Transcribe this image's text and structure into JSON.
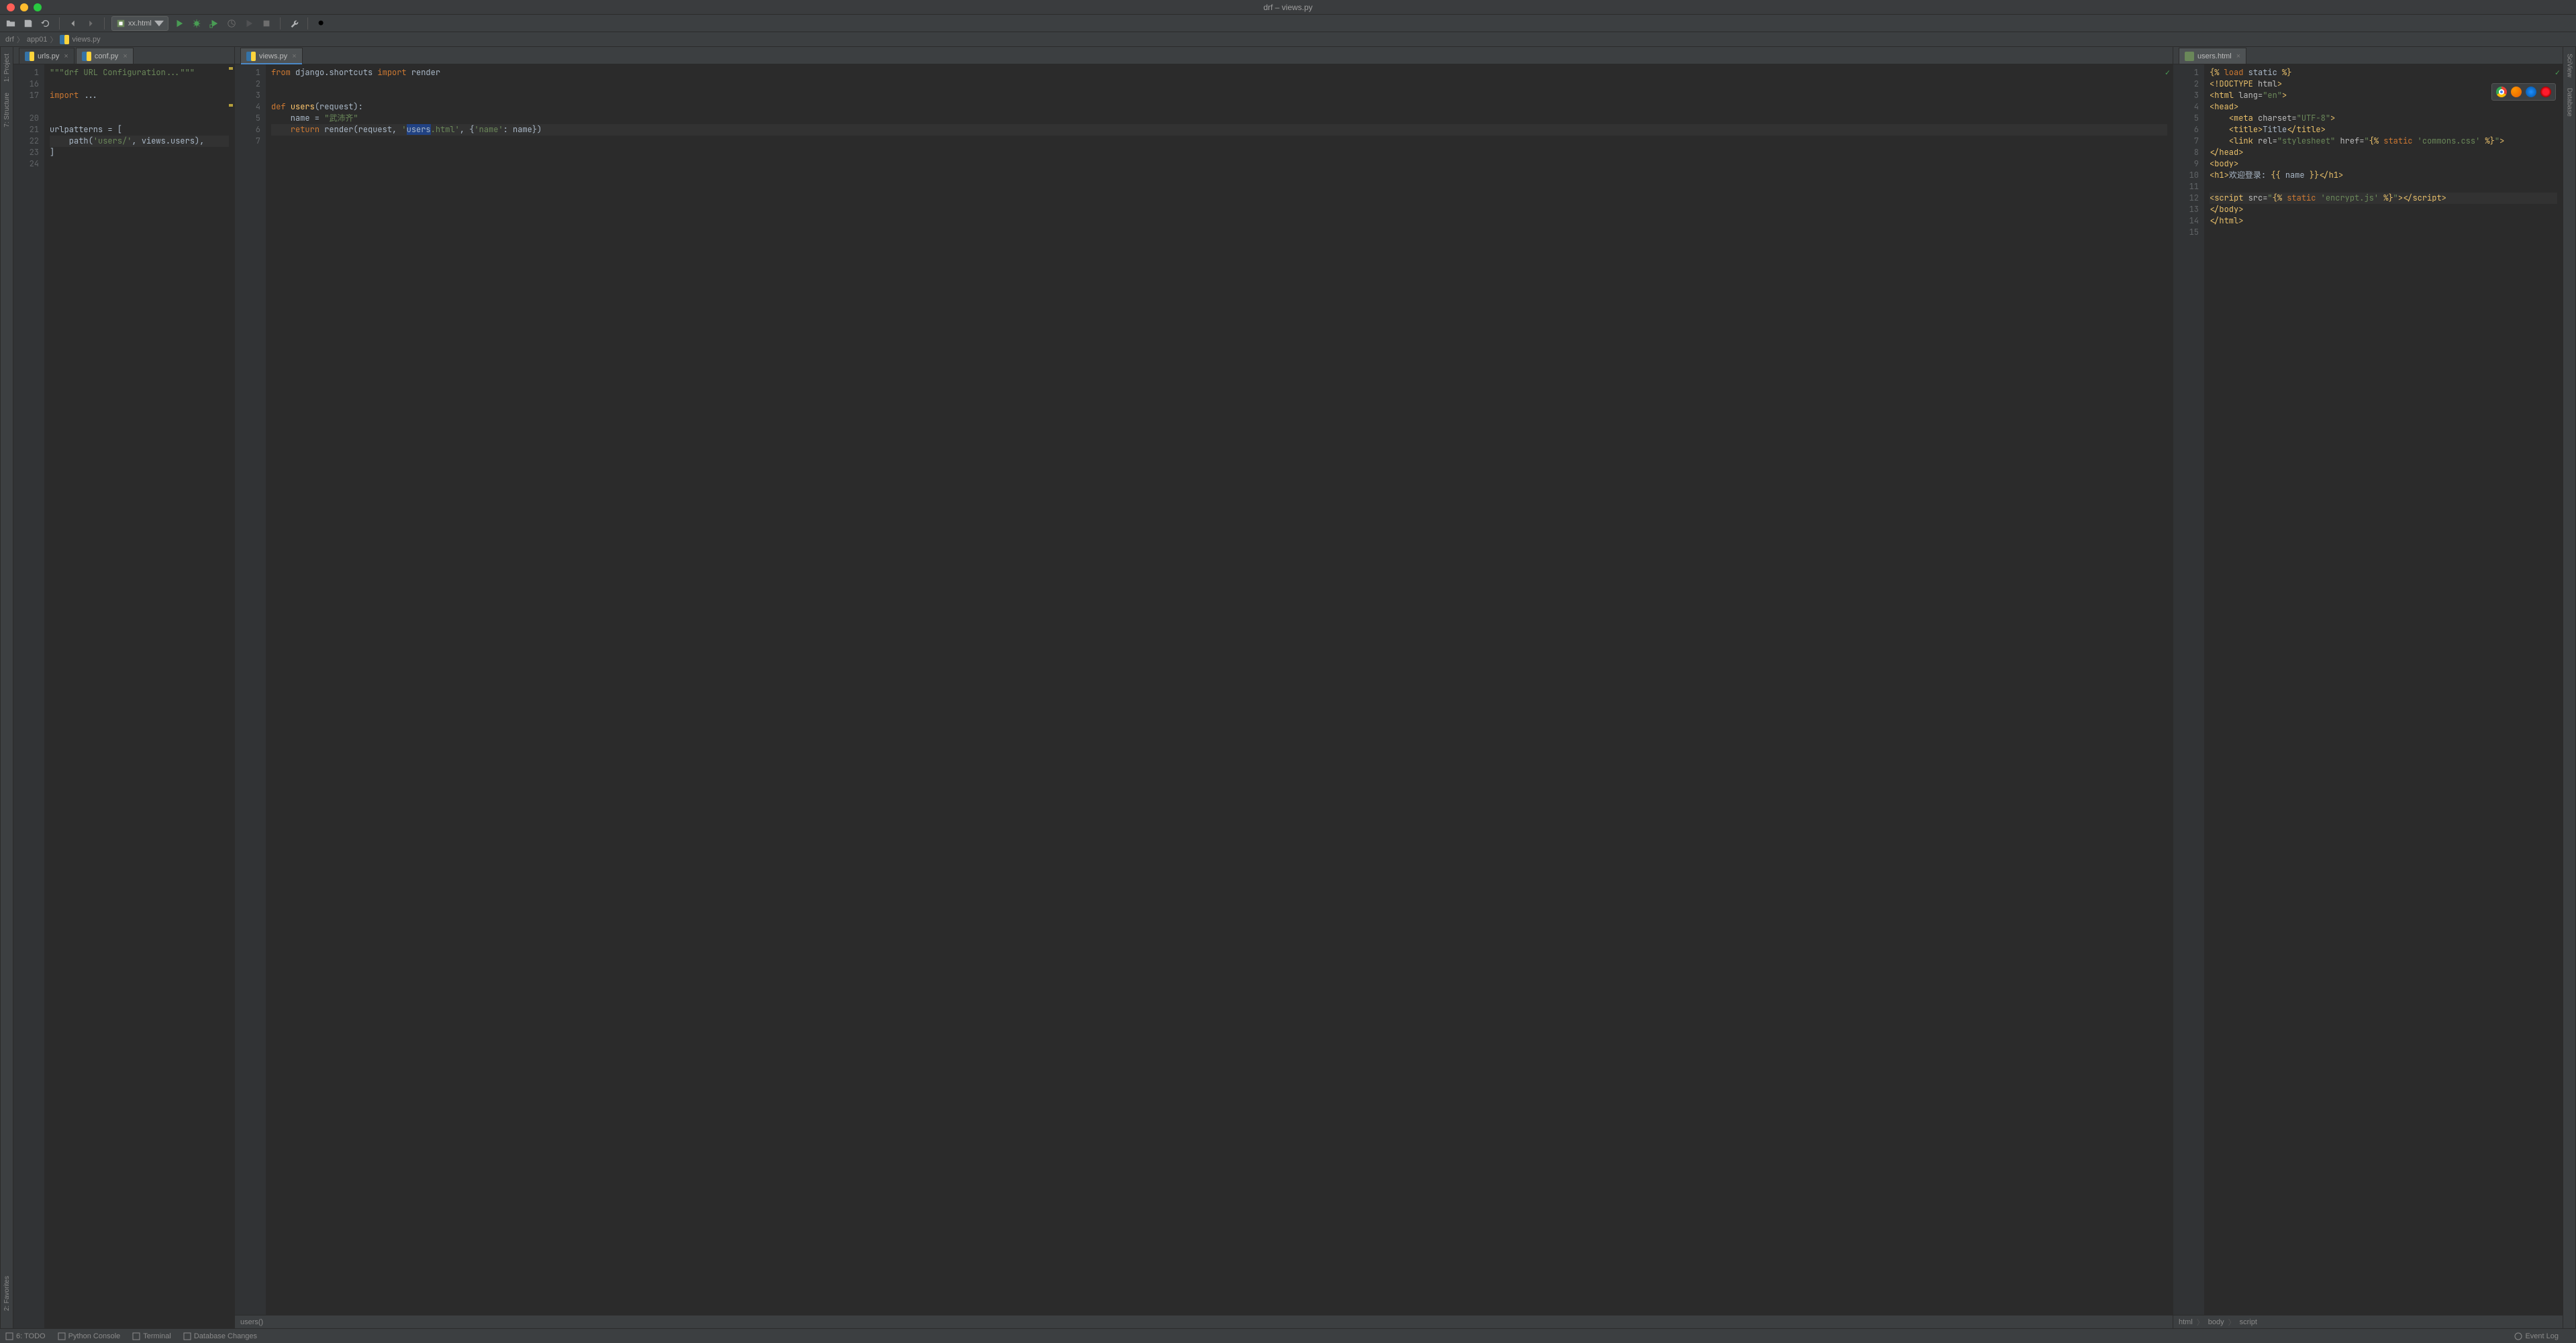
{
  "window": {
    "title": "drf – views.py"
  },
  "toolbar": {
    "run_config": "xx.html"
  },
  "breadcrumbs": [
    "drf",
    "app01",
    "views.py"
  ],
  "leftRail": [
    {
      "label": "1: Project"
    },
    {
      "label": "7: Structure"
    },
    {
      "label": "2: Favorites"
    }
  ],
  "rightRail": [
    {
      "label": "SciView"
    },
    {
      "label": "Database"
    }
  ],
  "panes": [
    {
      "tabs": [
        {
          "label": "urls.py",
          "icon": "py",
          "active": false
        },
        {
          "label": "conf.py",
          "icon": "py",
          "active": true
        }
      ],
      "gutterStart": 1,
      "gutterLines": [
        "1",
        "16",
        "17",
        "",
        "20",
        "21",
        "22",
        "23",
        "24"
      ],
      "code": [
        {
          "h": "<span class='str'>\"\"\"drf URL Configuration...\"\"\"</span>"
        },
        {
          "h": ""
        },
        {
          "h": "<span class='kw'>import</span> ..."
        },
        {
          "h": ""
        },
        {
          "h": ""
        },
        {
          "h": "urlpatterns = ["
        },
        {
          "h": "    path(<span class='str'>'users/'</span>, views.users),",
          "hl": true
        },
        {
          "h": "]"
        },
        {
          "h": ""
        }
      ],
      "marks": [
        {
          "line": 0,
          "type": "warn"
        },
        {
          "line": 3,
          "type": "warn"
        }
      ]
    },
    {
      "tabs": [
        {
          "label": "views.py",
          "icon": "py",
          "active": true,
          "blue": true
        }
      ],
      "gutterLines": [
        "1",
        "2",
        "3",
        "4",
        "5",
        "6",
        "7"
      ],
      "code": [
        {
          "h": "<span class='kw'>from</span> django.shortcuts <span class='kw'>import</span> render"
        },
        {
          "h": ""
        },
        {
          "h": ""
        },
        {
          "h": "<span class='kw'>def </span><span class='fn'>users</span>(request):"
        },
        {
          "h": "    name = <span class='str'>\"武沛齐\"</span>"
        },
        {
          "h": "    <span class='kw'>return</span> render(request, <span class='str'>'</span><span class='sel'>users</span><span class='str'>.html'</span>, {<span class='str'>'name'</span>: name})",
          "hl": true
        },
        {
          "h": ""
        }
      ],
      "footCrumb": "users()",
      "check": true
    },
    {
      "tabs": [
        {
          "label": "users.html",
          "icon": "html",
          "active": true
        }
      ],
      "gutterLines": [
        "1",
        "2",
        "3",
        "4",
        "5",
        "6",
        "7",
        "8",
        "9",
        "10",
        "11",
        "12",
        "13",
        "14",
        "15"
      ],
      "code": [
        {
          "h": "<span class='tag'>{% </span><span class='kw'>load</span> static <span class='tag'>%}</span>"
        },
        {
          "h": "<span class='tag'>&lt;!DOCTYPE </span><span class='attr'>html</span><span class='tag'>&gt;</span>"
        },
        {
          "h": "<span class='tag'>&lt;html </span><span class='attr'>lang=</span><span class='val'>\"en\"</span><span class='tag'>&gt;</span>"
        },
        {
          "h": "<span class='tag'>&lt;head&gt;</span>"
        },
        {
          "h": "    <span class='tag'>&lt;meta </span><span class='attr'>charset=</span><span class='val'>\"UTF-8\"</span><span class='tag'>&gt;</span>"
        },
        {
          "h": "    <span class='tag'>&lt;title&gt;</span>Title<span class='tag'>&lt;/title&gt;</span>"
        },
        {
          "h": "    <span class='tag'>&lt;link </span><span class='attr'>rel=</span><span class='val'>\"stylesheet\"</span> <span class='attr'>href=</span><span class='val'>\"</span><span class='tag'>{% </span><span class='kw'>static</span> <span class='val'>'commons.css'</span> <span class='tag'>%}</span><span class='val'>\"</span><span class='tag'>&gt;</span>"
        },
        {
          "h": "<span class='tag'>&lt;/head&gt;</span>"
        },
        {
          "h": "<span class='tag'>&lt;body&gt;</span>"
        },
        {
          "h": "<span class='tag'>&lt;h1&gt;</span>欢迎登录: <span class='tag'>{{</span> name <span class='tag'>}}</span><span class='tag'>&lt;/h1&gt;</span>"
        },
        {
          "h": ""
        },
        {
          "h": "<span class='tag'>&lt;script </span><span class='attr'>src=</span><span class='val'>\"</span><span class='tag'>{% </span><span class='kw'>static</span> <span class='val'>'encrypt.js'</span> <span class='tag'>%}</span><span class='val'>\"</span><span class='tag'>&gt;&lt;/script&gt;</span>",
          "hl": true
        },
        {
          "h": "<span class='tag'>&lt;/body&gt;</span>"
        },
        {
          "h": "<span class='tag'>&lt;/html&gt;</span>"
        },
        {
          "h": ""
        }
      ],
      "browsers": true,
      "check": true,
      "footCrumbs": [
        "html",
        "body",
        "script"
      ]
    }
  ],
  "bottomTools": [
    {
      "label": "6: TODO",
      "icon": "list"
    },
    {
      "label": "Python Console",
      "icon": "py"
    },
    {
      "label": "Terminal",
      "icon": "term"
    },
    {
      "label": "Database Changes",
      "icon": "db"
    }
  ],
  "statusRight": "Event Log"
}
